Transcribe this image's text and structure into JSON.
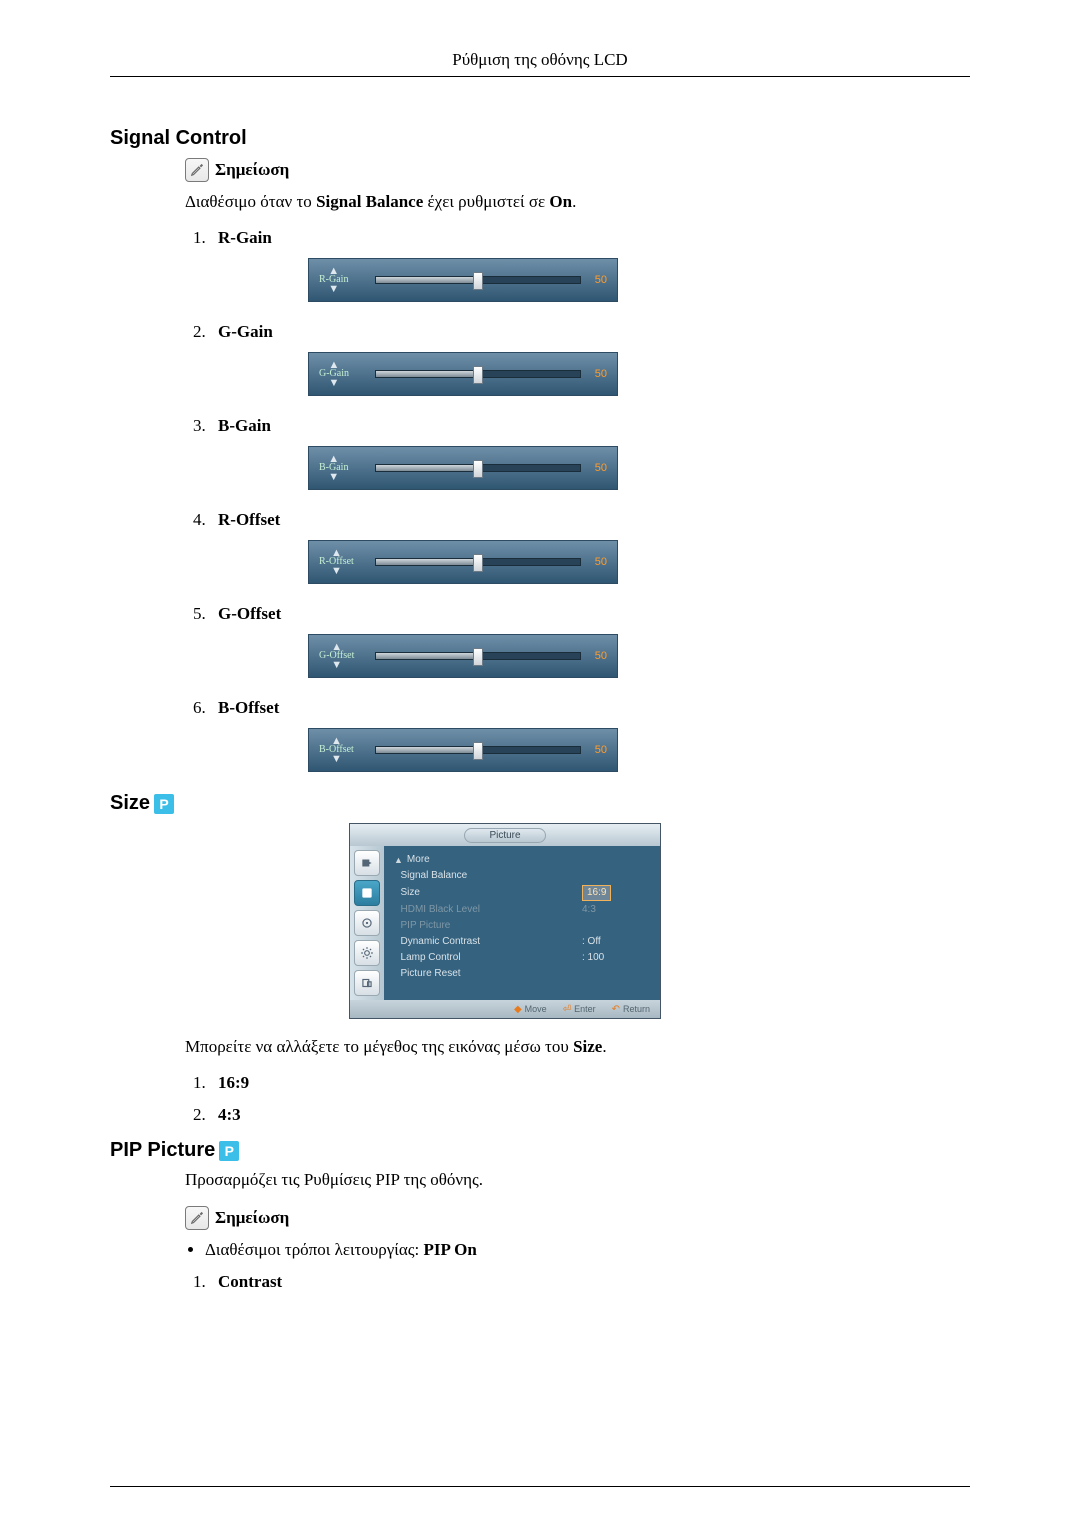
{
  "header": {
    "title": "Ρύθμιση της οθόνης LCD"
  },
  "signal_control": {
    "title": "Signal Control",
    "note_label": "Σημείωση",
    "availability_pre": "Διαθέσιμο όταν το ",
    "availability_bold": "Signal Balance",
    "availability_mid": " έχει ρυθμιστεί σε ",
    "availability_on": "On",
    "availability_post": ".",
    "items": [
      {
        "label": "R-Gain",
        "slider_label": "R-Gain",
        "value": 50,
        "pct": 50
      },
      {
        "label": "G-Gain",
        "slider_label": "G-Gain",
        "value": 50,
        "pct": 50
      },
      {
        "label": "B-Gain",
        "slider_label": "B-Gain",
        "value": 50,
        "pct": 50
      },
      {
        "label": "R-Offset",
        "slider_label": "R-Offset",
        "value": 50,
        "pct": 50
      },
      {
        "label": "G-Offset",
        "slider_label": "G-Offset",
        "value": 50,
        "pct": 50
      },
      {
        "label": "B-Offset",
        "slider_label": "B-Offset",
        "value": 50,
        "pct": 50
      }
    ]
  },
  "size": {
    "title": "Size",
    "osd": {
      "tab": "Picture",
      "menu": [
        {
          "label": "More",
          "caret": "▲",
          "value": "",
          "dim": false
        },
        {
          "label": "Signal Balance",
          "value": "",
          "dim": false
        },
        {
          "label": "Size",
          "value": "16:9",
          "dim": false,
          "selected": true
        },
        {
          "label": "HDMI Black Level",
          "value": "4:3",
          "dim": true
        },
        {
          "label": "PIP Picture",
          "value": "",
          "dim": true
        },
        {
          "label": "Dynamic Contrast",
          "value": ": Off",
          "dim": false
        },
        {
          "label": "Lamp Control",
          "value": ": 100",
          "dim": false
        },
        {
          "label": "Picture Reset",
          "value": "",
          "dim": false
        }
      ],
      "footer": {
        "move": "Move",
        "enter": "Enter",
        "return": "Return"
      }
    },
    "desc_pre": "Μπορείτε να αλλάξετε το μέγεθος της εικόνας μέσω του ",
    "desc_bold": "Size",
    "desc_post": ".",
    "options": [
      "16:9",
      "4:3"
    ]
  },
  "pip": {
    "title": "PIP Picture",
    "desc": "Προσαρμόζει τις Ρυθμίσεις PIP της οθόνης.",
    "note_label": "Σημείωση",
    "bullet_pre": "Διαθέσιμοι τρόποι λειτουργίας: ",
    "bullet_bold": "PIP On",
    "items": [
      "Contrast"
    ]
  }
}
